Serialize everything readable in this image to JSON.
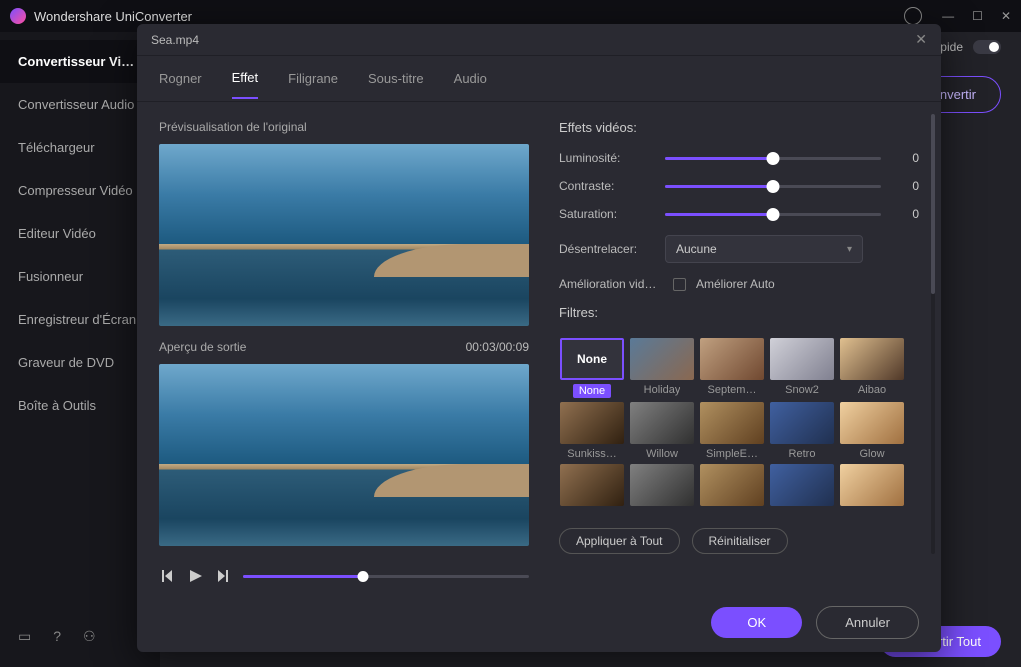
{
  "app": {
    "title": "Wondershare UniConverter"
  },
  "sidebar": {
    "items": [
      "Convertisseur Vidéo",
      "Convertisseur Audio",
      "Téléchargeur",
      "Compresseur Vidéo",
      "Editeur Vidéo",
      "Fusionneur",
      "Enregistreur d'Écran",
      "Graveur de DVD",
      "Boîte à Outils"
    ]
  },
  "topright": {
    "rapide": "rapide"
  },
  "convert": {
    "btn": "Convertir",
    "all": "Convertir Tout"
  },
  "dialog": {
    "file": "Sea.mp4",
    "tabs": {
      "rogner": "Rogner",
      "effet": "Effet",
      "filigrane": "Filigrane",
      "soustitre": "Sous-titre",
      "audio": "Audio"
    },
    "left": {
      "original": "Prévisualisation de l'original",
      "output": "Aperçu de sortie",
      "timecode": "00:03/00:09"
    },
    "effects": {
      "title": "Effets vidéos:",
      "brightness": {
        "label": "Luminosité:",
        "value": "0"
      },
      "contrast": {
        "label": "Contraste:",
        "value": "0"
      },
      "saturation": {
        "label": "Saturation:",
        "value": "0"
      },
      "deinterlace": {
        "label": "Désentrelacer:",
        "value": "Aucune"
      },
      "enhance": {
        "label": "Amélioration vid…",
        "auto": "Améliorer Auto"
      },
      "filters_label": "Filtres:"
    },
    "filters": [
      {
        "none_thumb": "None",
        "name": "None",
        "selected": true
      },
      {
        "name": "Holiday",
        "variant": 1
      },
      {
        "name": "Septem…",
        "variant": 2
      },
      {
        "name": "Snow2",
        "variant": 3
      },
      {
        "name": "Aibao",
        "variant": 4
      },
      {
        "name": "Sunkiss…",
        "variant": 5
      },
      {
        "name": "Willow",
        "variant": 6
      },
      {
        "name": "SimpleE…",
        "variant": 7
      },
      {
        "name": "Retro",
        "variant": 8
      },
      {
        "name": "Glow",
        "variant": 9
      },
      {
        "name": "",
        "variant": 5
      },
      {
        "name": "",
        "variant": 6
      },
      {
        "name": "",
        "variant": 7
      },
      {
        "name": "",
        "variant": 8
      },
      {
        "name": "",
        "variant": 9
      }
    ],
    "actions": {
      "apply_all": "Appliquer à Tout",
      "reset": "Réinitialiser",
      "ok": "OK",
      "cancel": "Annuler"
    }
  }
}
